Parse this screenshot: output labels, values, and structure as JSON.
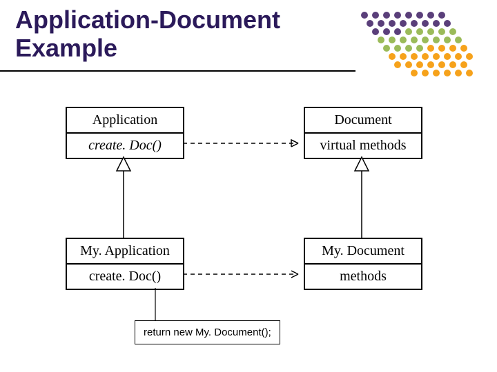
{
  "title_line1": "Application-Document",
  "title_line2": "Example",
  "classes": {
    "application": {
      "name": "Application",
      "method": "create. Doc()"
    },
    "document": {
      "name": "Document",
      "method": "virtual methods"
    },
    "myapplication": {
      "name": "My. Application",
      "method": "create. Doc()"
    },
    "mydocument": {
      "name": "My. Document",
      "method": "methods"
    }
  },
  "note": "return new My. Document();",
  "dot_colors": {
    "purple": "#5a3f7a",
    "green": "#9bbb59",
    "orange": "#f6a21b"
  }
}
